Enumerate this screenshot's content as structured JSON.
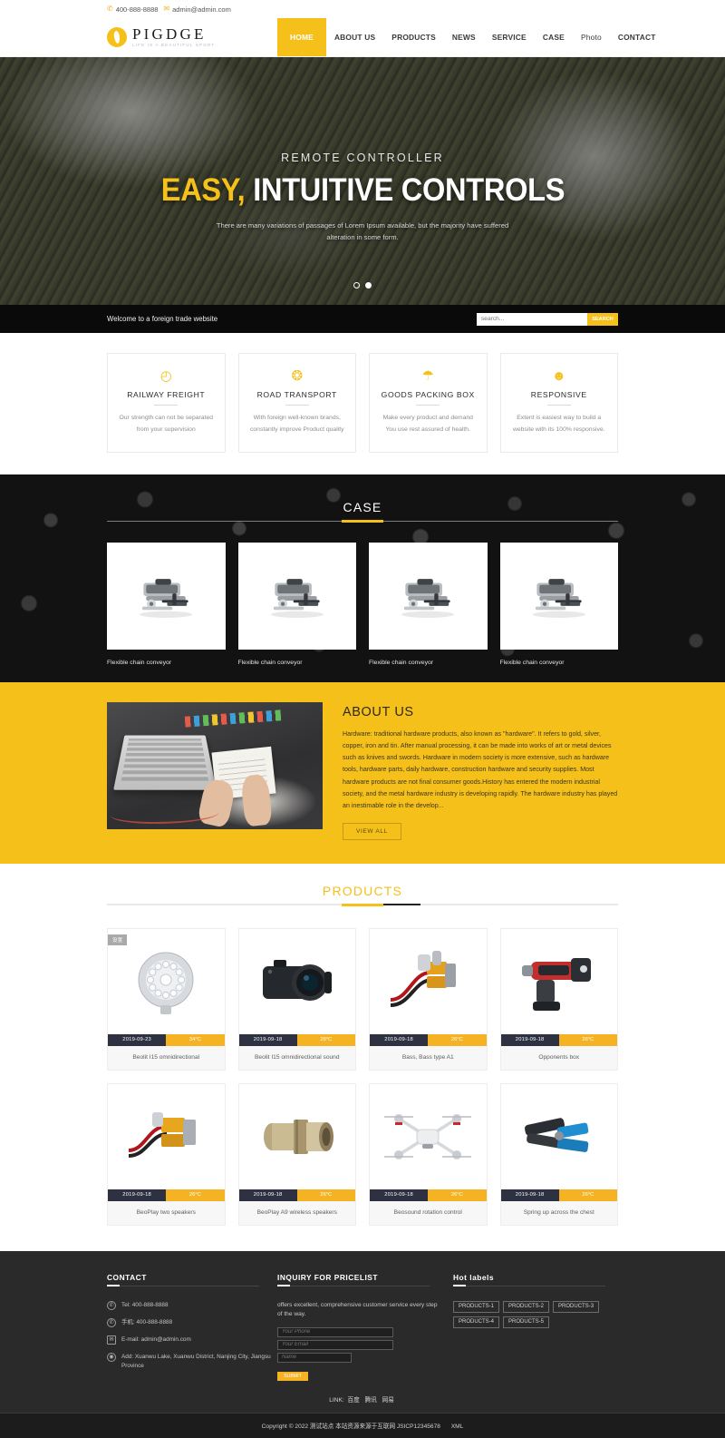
{
  "topbar": {
    "phone_icon": "phone-icon",
    "phone": "400-888-8888",
    "mail_icon": "mail-icon",
    "email": "admin@admin.com"
  },
  "header": {
    "logo_name": "PIGDGE",
    "logo_tagline": "LIFE IS A BEAUTIFUL SPORT",
    "nav": [
      {
        "label": "HOME",
        "active": true
      },
      {
        "label": "ABOUT US",
        "active": false
      },
      {
        "label": "PRODUCTS",
        "active": false
      },
      {
        "label": "NEWS",
        "active": false
      },
      {
        "label": "SERVICE",
        "active": false
      },
      {
        "label": "CASE",
        "active": false
      },
      {
        "label": "Photo",
        "active": false
      },
      {
        "label": "CONTACT",
        "active": false
      }
    ]
  },
  "hero": {
    "subtitle": "REMOTE CONTROLLER",
    "title_accent": "EASY,",
    "title_rest": " INTUITIVE CONTROLS",
    "description": "There are many variations of passages of Lorem Ipsum available, but the majority have suffered alteration in some form.",
    "dots": 2,
    "active_dot": 2
  },
  "strip": {
    "welcome": "Welcome to a foreign trade website",
    "search_placeholder": "search...",
    "search_value": "",
    "search_button": "SEARCH"
  },
  "features": [
    {
      "icon": "pie-chart-icon",
      "glyph": "◴",
      "title": "RAILWAY FREIGHT",
      "desc": "Our strength can not be separated from your supervision"
    },
    {
      "icon": "gear-icon",
      "glyph": "❂",
      "title": "ROAD TRANSPORT",
      "desc": "With foreign well-known brands, constantly improve Product quality"
    },
    {
      "icon": "umbrella-icon",
      "glyph": "☂",
      "title": "GOODS PACKING BOX",
      "desc": "Make every product and demand You use rest assured of health."
    },
    {
      "icon": "user-icon",
      "glyph": "☻",
      "title": "RESPONSIVE",
      "desc": "Extent is easiest way to build a website with its 100% responsive."
    }
  ],
  "case": {
    "title": "CASE",
    "items": [
      {
        "caption": "Flexible chain conveyor"
      },
      {
        "caption": "Flexible chain conveyor"
      },
      {
        "caption": "Flexible chain conveyor"
      },
      {
        "caption": "Flexible chain conveyor"
      }
    ]
  },
  "about": {
    "title": "ABOUT US",
    "image_name": "desk-workspace-photo",
    "text": "Hardware: traditional hardware products, also known as \"hardware\". It refers to gold, silver, copper, iron and tin. After manual processing, it can be made into works of art or metal devices such as knives and swords. Hardware in modern society is more extensive, such as hardware tools, hardware parts, daily hardware, construction hardware and security supplies. Most hardware products are not final consumer goods.History has entered the modern industrial society, and the metal hardware industry is developing rapidly. The hardware industry has played an inestimable role in the develop...",
    "button": "VIEW ALL"
  },
  "products": {
    "title": "PRODUCTS",
    "items": [
      {
        "name": "Beolit I15 omnidirectional",
        "date": "2019-09-23",
        "temp": "34°C",
        "badge": "设置",
        "image_name": "led-ring-light-product"
      },
      {
        "name": "Beolit I15 omnidirectional sound",
        "date": "2019-09-18",
        "temp": "28°C",
        "badge": "",
        "image_name": "dslr-camera-product"
      },
      {
        "name": "Bass, Bass type A1",
        "date": "2019-09-18",
        "temp": "26°C",
        "badge": "",
        "image_name": "wire-connector-product"
      },
      {
        "name": "Opponents box",
        "date": "2019-09-18",
        "temp": "26°C",
        "badge": "",
        "image_name": "cordless-rebar-tier-product"
      },
      {
        "name": "BeoPlay two speakers",
        "date": "2019-09-18",
        "temp": "26°C",
        "badge": "",
        "image_name": "terminal-block-product"
      },
      {
        "name": "BeoPlay A9 wireless speakers",
        "date": "2019-09-18",
        "temp": "26°C",
        "badge": "",
        "image_name": "metal-coupling-product"
      },
      {
        "name": "Beosound rotation control",
        "date": "2019-09-18",
        "temp": "26°C",
        "badge": "",
        "image_name": "quadcopter-drone-product"
      },
      {
        "name": "Spring up across the chest",
        "date": "2019-09-18",
        "temp": "26°C",
        "badge": "",
        "image_name": "crimping-tool-product"
      }
    ]
  },
  "footer": {
    "contact": {
      "title": "CONTACT",
      "rows": [
        {
          "icon": "phone-icon",
          "glyph": "✆",
          "text": "Tel:  400-888-8888"
        },
        {
          "icon": "whatsapp-icon",
          "glyph": "✆",
          "text": "手机:  400-888-8888"
        },
        {
          "icon": "mail-icon",
          "glyph": "✉",
          "text": "E-mail: admin@admin.com"
        },
        {
          "icon": "location-pin-icon",
          "glyph": "◉",
          "text": "Add:  Xuanwu Lake, Xuanwu District, Nanjing City, Jiangsu Province"
        }
      ]
    },
    "inquiry": {
      "title": "INQUIRY FOR PRICELIST",
      "intro": "offers excellent, comprehensive customer service every step of the way.",
      "phone_placeholder": "Your Phone",
      "email_placeholder": "Your Email",
      "name_placeholder": "Name",
      "submit": "SUBMIT"
    },
    "hot": {
      "title": "Hot labels",
      "tags": [
        "PRODUCTS-1",
        "PRODUCTS-2",
        "PRODUCTS-3",
        "PRODUCTS-4",
        "PRODUCTS-5"
      ]
    },
    "linkbar": {
      "label": "LINK:",
      "links": [
        "百度",
        "腾讯",
        "网易"
      ]
    },
    "copyright": "Copyright © 2022 测试站点 本站资源来源于互联网 JSICP12345678",
    "xml": "XML"
  },
  "colors": {
    "accent": "#f5c01a",
    "accent_orange": "#f5b323",
    "dark": "#1c1c1c",
    "footer_bg": "#2a2a2a",
    "badge_navy": "#2d3142"
  }
}
